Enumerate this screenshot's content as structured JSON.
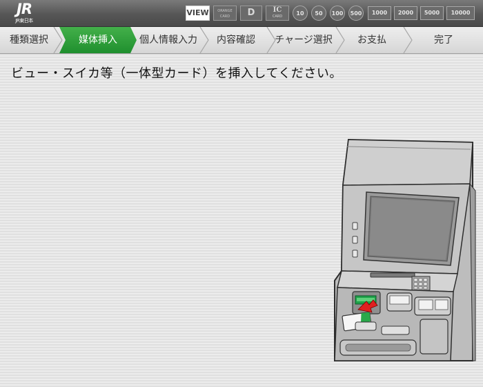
{
  "header": {
    "logo": {
      "main": "JR",
      "sub": "JR東日本"
    },
    "payment_methods": {
      "view": "VIEW",
      "orange_card": [
        "ORANGE",
        "CARD"
      ],
      "d_card": "D",
      "ic_card": {
        "main": "IC",
        "sub": "CARD"
      }
    },
    "coins": [
      "10",
      "50",
      "100",
      "500"
    ],
    "bills": [
      "1000",
      "2000",
      "5000",
      "10000"
    ]
  },
  "steps": [
    {
      "label": "種類選択",
      "state": "done"
    },
    {
      "label": "媒体挿入",
      "state": "active"
    },
    {
      "label": "個人情報入力",
      "state": "pending"
    },
    {
      "label": "内容確認",
      "state": "pending"
    },
    {
      "label": "チャージ選択",
      "state": "pending"
    },
    {
      "label": "お支払",
      "state": "pending"
    },
    {
      "label": "完了",
      "state": "pending"
    }
  ],
  "main": {
    "instruction": "ビュー・スイカ等（一体型カード）を挿入してください。"
  },
  "colors": {
    "active_step": "#2fa23a",
    "slot_indicator": "#1fa24a",
    "insert_arrow": "#e02020"
  }
}
